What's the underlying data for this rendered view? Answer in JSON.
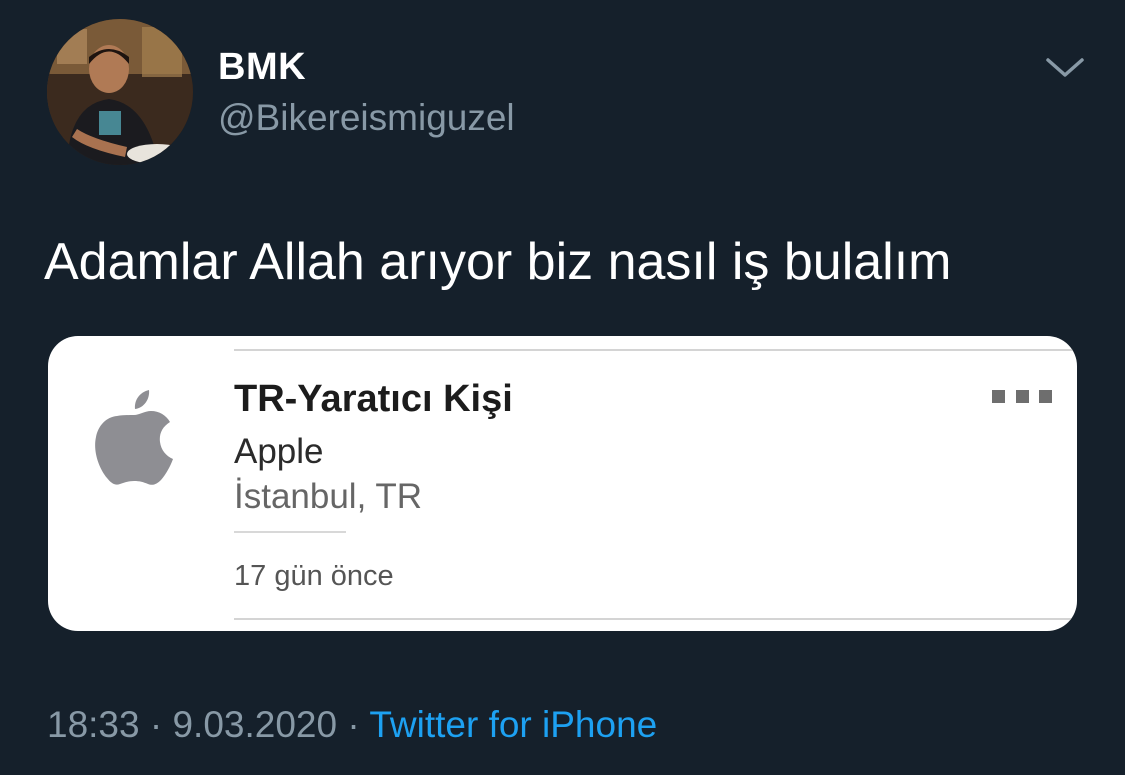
{
  "tweet": {
    "user": {
      "name": "BMK",
      "handle": "@Bikereismiguzel"
    },
    "text": "Adamlar Allah arıyor biz nasıl iş bulalım",
    "card": {
      "logo_icon": "apple-logo-icon",
      "job_title": "TR-Yaratıcı Kişi",
      "company": "Apple",
      "location": "İstanbul, TR",
      "posted": "17 gün önce",
      "more_icon": "more-dots-icon"
    },
    "meta": {
      "time": "18:33",
      "separator": "·",
      "date": "9.03.2020",
      "source": "Twitter for iPhone"
    }
  },
  "colors": {
    "background": "#15202b",
    "primary_text": "#ffffff",
    "secondary_text": "#8899a6",
    "link": "#1da1f2",
    "card_background": "#ffffff"
  }
}
